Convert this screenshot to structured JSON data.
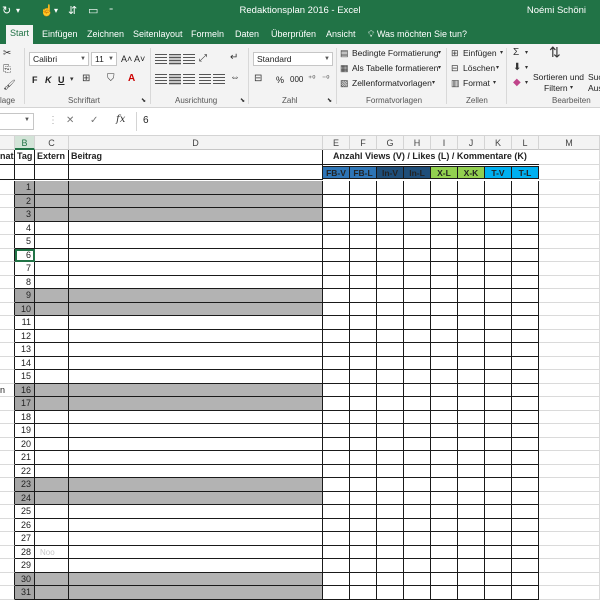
{
  "titlebar": {
    "title": "Redaktionsplan 2016  -  Excel",
    "user": "Noémi Schöni",
    "bg": "#217346"
  },
  "tabs": [
    {
      "label": "Start",
      "active": true
    },
    {
      "label": "Einfügen"
    },
    {
      "label": "Zeichnen"
    },
    {
      "label": "Seitenlayout"
    },
    {
      "label": "Formeln"
    },
    {
      "label": "Daten"
    },
    {
      "label": "Überprüfen"
    },
    {
      "label": "Ansicht"
    }
  ],
  "tell_me": "Was möchten Sie tun?",
  "ribbon": {
    "font_name": "Calibri",
    "font_size": "11",
    "number_format": "Standard",
    "bold": "F",
    "italic": "K",
    "underline": "U",
    "grow_font": "A˄",
    "shrink_font": "A˅",
    "percent": "%",
    "thousands": "000",
    "conditional_formatting": "Bedingte Formatierung",
    "format_as_table": "Als Tabelle formatieren",
    "cell_styles": "Zellenformatvorlagen",
    "insert": "Einfügen",
    "delete": "Löschen",
    "format": "Format",
    "sort_filter_1": "Sortieren und",
    "sort_filter_2": "Filtern",
    "find_1": "Such",
    "find_2": "Aus",
    "groups": {
      "clipboard": "lage",
      "font": "Schriftart",
      "alignment": "Ausrichtung",
      "number": "Zahl",
      "styles": "Formatvorlagen",
      "cells": "Zellen",
      "editing": "Bearbeiten"
    }
  },
  "formula_bar": {
    "name_box": "",
    "value": "6",
    "fx": "fx",
    "cancel_icon": "✕",
    "enter_icon": "✓"
  },
  "columns": [
    "B",
    "C",
    "D",
    "E",
    "F",
    "G",
    "H",
    "I",
    "J",
    "K",
    "L",
    "M"
  ],
  "header_row": {
    "a_partial": "nat",
    "b": "Tag",
    "c": "Extern",
    "d": "Beitrag",
    "group": "Anzahl Views (V) / Likes (L) / Kommentare (K)"
  },
  "subheaders": [
    {
      "label": "FB-V",
      "color": "#2e75b6"
    },
    {
      "label": "FB-L",
      "color": "#2e75b6"
    },
    {
      "label": "In-V",
      "color": "#1f4e79"
    },
    {
      "label": "In-L",
      "color": "#1f4e79"
    },
    {
      "label": "X-L",
      "color": "#92d050"
    },
    {
      "label": "X-K",
      "color": "#92d050"
    },
    {
      "label": "T-V",
      "color": "#00b0f0"
    },
    {
      "label": "T-L",
      "color": "#00b0f0"
    }
  ],
  "days": [
    "1",
    "2",
    "3",
    "4",
    "5",
    "6",
    "7",
    "8",
    "9",
    "10",
    "11",
    "12",
    "13",
    "14",
    "15",
    "16",
    "17",
    "18",
    "19",
    "20",
    "21",
    "22",
    "23",
    "24",
    "25",
    "26",
    "27",
    "28",
    "29",
    "30",
    "31"
  ],
  "gray_days": [
    1,
    2,
    3,
    9,
    10,
    16,
    17,
    23,
    24,
    30,
    31
  ],
  "selected_day": 6,
  "partial_a_text": "n",
  "faint_text": "Noo"
}
